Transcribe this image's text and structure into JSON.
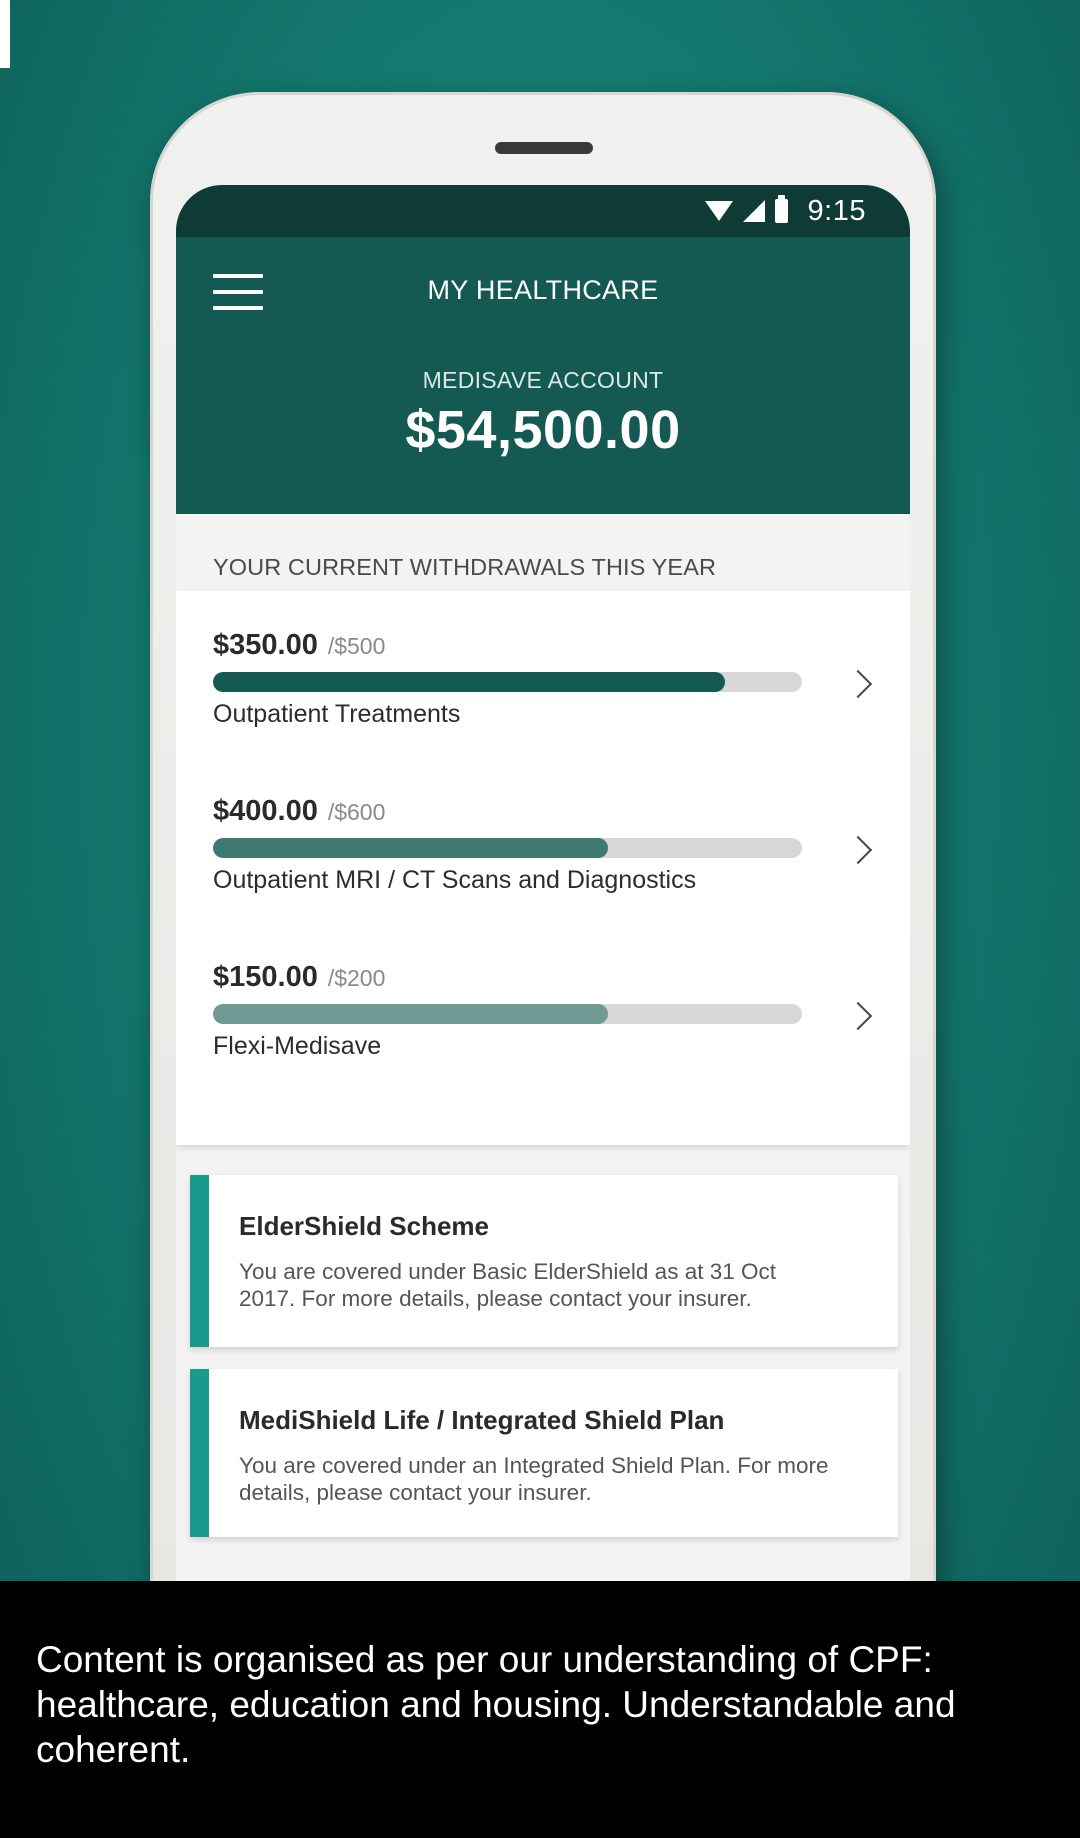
{
  "status_bar": {
    "time": "9:15"
  },
  "header": {
    "title": "MY HEALTHCARE",
    "account_label": "MEDISAVE ACCOUNT",
    "account_balance": "$54,500.00"
  },
  "withdrawals": {
    "section_title": "YOUR CURRENT WITHDRAWALS THIS YEAR",
    "items": [
      {
        "amount": "$350.00",
        "limit": "/$500",
        "label": "Outpatient Treatments",
        "progress_fraction": 0.87,
        "bar_color": "#145a52"
      },
      {
        "amount": "$400.00",
        "limit": "/$600",
        "label": "Outpatient MRI / CT Scans and Diagnostics",
        "progress_fraction": 0.67,
        "bar_color": "#3f7a72"
      },
      {
        "amount": "$150.00",
        "limit": "/$200",
        "label": "Flexi-Medisave",
        "progress_fraction": 0.67,
        "bar_color": "#6f9a93"
      }
    ]
  },
  "info_cards": [
    {
      "title": "ElderShield Scheme",
      "text": "You are covered under Basic ElderShield as at 31 Oct 2017. For more details, please contact your insurer."
    },
    {
      "title": "MediShield Life / Integrated Shield Plan",
      "text": "You are covered under an Integrated Shield Plan. For more details, please contact your insurer."
    }
  ],
  "caption": "Content is organised as per our understanding of CPF: healthcare, education and housing. Understandable and coherent.",
  "colors": {
    "header": "#145a52",
    "status_bar": "#0e3b36",
    "accent": "#1a9a8c",
    "background": "#157a70"
  }
}
